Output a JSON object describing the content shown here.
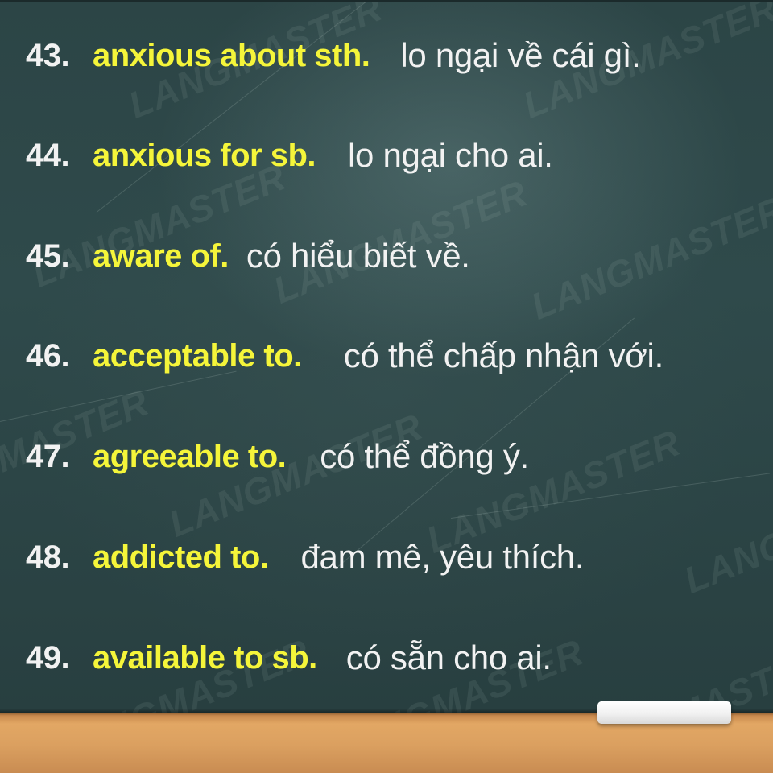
{
  "watermark_text": "LANGMASTER",
  "colors": {
    "board": "#2f4a4b",
    "number_text": "#f2f2f2",
    "english_text": "#f5f53a",
    "vietnamese_text": "#f2f2f2",
    "ledge": "#dba060"
  },
  "items": [
    {
      "number": "43.",
      "english": "anxious about sth.",
      "vietnamese": "lo ngại về cái gì."
    },
    {
      "number": "44.",
      "english": "anxious for sb.",
      "vietnamese": "lo ngại cho ai."
    },
    {
      "number": "45.",
      "english": "aware of.",
      "vietnamese": "có hiểu biết về."
    },
    {
      "number": "46.",
      "english": "acceptable to.",
      "vietnamese": "có thể chấp nhận với."
    },
    {
      "number": "47.",
      "english": "agreeable to.",
      "vietnamese": "có thể đồng ý."
    },
    {
      "number": "48.",
      "english": "addicted to.",
      "vietnamese": "đam mê, yêu thích."
    },
    {
      "number": "49.",
      "english": "available to sb.",
      "vietnamese": "có sẵn cho ai."
    }
  ]
}
